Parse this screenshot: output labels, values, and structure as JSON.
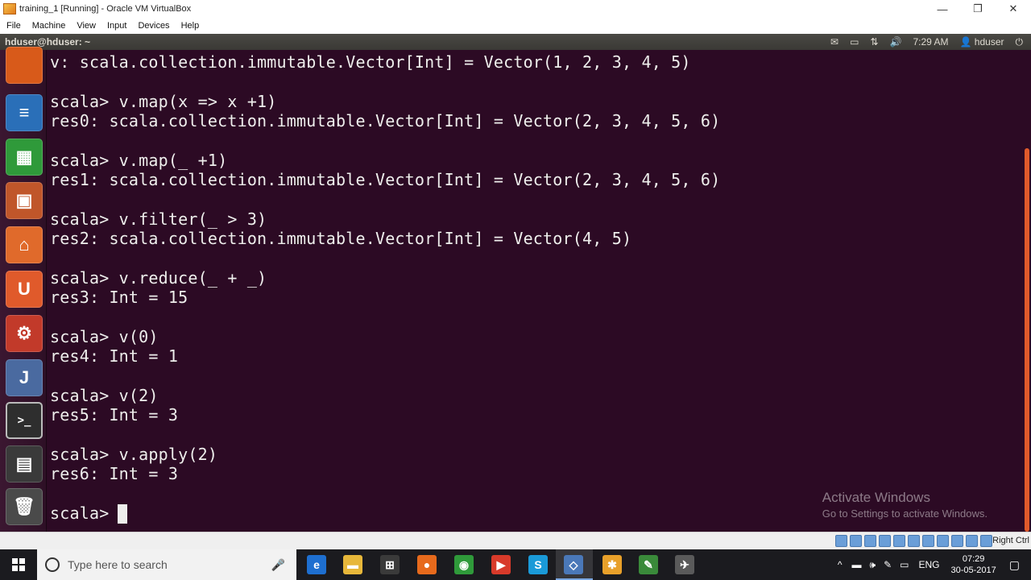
{
  "window": {
    "title": "training_1 [Running] - Oracle VM VirtualBox",
    "minimize_glyph": "—",
    "restore_glyph": "❐",
    "close_glyph": "✕"
  },
  "menubar": {
    "items": [
      "File",
      "Machine",
      "View",
      "Input",
      "Devices",
      "Help"
    ]
  },
  "panel": {
    "title": "hduser@hduser: ~",
    "time": "7:29 AM",
    "user": "hduser",
    "mail_glyph": "✉",
    "battery_glyph": "▭",
    "network_glyph": "⇅",
    "volume_glyph": "🔊",
    "user_glyph": "👤",
    "power_glyph": "⏻"
  },
  "launcher": {
    "icons": [
      {
        "name": "firefox-icon",
        "glyph": "",
        "color": "#d85a1a"
      },
      {
        "name": "writer-icon",
        "glyph": "≡",
        "color": "#2a6fb8"
      },
      {
        "name": "calc-icon",
        "glyph": "▦",
        "color": "#2f9a3a"
      },
      {
        "name": "impress-icon",
        "glyph": "▣",
        "color": "#c0562a"
      },
      {
        "name": "software-center-icon",
        "glyph": "⌂",
        "color": "#e06a2b"
      },
      {
        "name": "ubuntu-one-icon",
        "glyph": "U",
        "color": "#e05a2b"
      },
      {
        "name": "system-settings-icon",
        "glyph": "⚙",
        "color": "#c23a2a"
      },
      {
        "name": "intellij-icon",
        "glyph": "J",
        "color": "#4a6aa0"
      },
      {
        "name": "terminal-icon",
        "glyph": ">_",
        "color": "#2e2e2e"
      },
      {
        "name": "workspace-switcher-icon",
        "glyph": "▤",
        "color": "#3a3a3a"
      },
      {
        "name": "trash-icon",
        "glyph": "🗑",
        "color": "#4a4a4a"
      }
    ]
  },
  "terminal": {
    "lines": [
      "v: scala.collection.immutable.Vector[Int] = Vector(1, 2, 3, 4, 5)",
      "",
      "scala> v.map(x => x +1)",
      "res0: scala.collection.immutable.Vector[Int] = Vector(2, 3, 4, 5, 6)",
      "",
      "scala> v.map(_ +1)",
      "res1: scala.collection.immutable.Vector[Int] = Vector(2, 3, 4, 5, 6)",
      "",
      "scala> v.filter(_ > 3)",
      "res2: scala.collection.immutable.Vector[Int] = Vector(4, 5)",
      "",
      "scala> v.reduce(_ + _)",
      "res3: Int = 15",
      "",
      "scala> v(0)",
      "res4: Int = 1",
      "",
      "scala> v(2)",
      "res5: Int = 3",
      "",
      "scala> v.apply(2)",
      "res6: Int = 3",
      "",
      "scala> "
    ]
  },
  "watermark": {
    "line1": "Activate Windows",
    "line2": "Go to Settings to activate Windows."
  },
  "statusbar": {
    "host_key": "Right Ctrl"
  },
  "taskbar": {
    "search_placeholder": "Type here to search",
    "mic_glyph": "🎤",
    "apps": [
      {
        "name": "edge-icon",
        "glyph": "e",
        "color": "#1e6fd0"
      },
      {
        "name": "file-explorer-icon",
        "glyph": "▬",
        "color": "#e7b73a"
      },
      {
        "name": "store-icon",
        "glyph": "⊞",
        "color": "#3a3a3a"
      },
      {
        "name": "firefox-icon",
        "glyph": "●",
        "color": "#e76a1c"
      },
      {
        "name": "chrome-icon",
        "glyph": "◉",
        "color": "#2f9a3a"
      },
      {
        "name": "app-red-icon",
        "glyph": "▶",
        "color": "#d83a2a"
      },
      {
        "name": "skype-icon",
        "glyph": "S",
        "color": "#1a9ad8"
      },
      {
        "name": "virtualbox-icon",
        "glyph": "◇",
        "color": "#4a78b8"
      },
      {
        "name": "flower-app-icon",
        "glyph": "✱",
        "color": "#e8a02a"
      },
      {
        "name": "notepad-icon",
        "glyph": "✎",
        "color": "#3a8a3a"
      },
      {
        "name": "tool-icon",
        "glyph": "✈",
        "color": "#5a5a5a"
      }
    ],
    "tray": {
      "chevron": "^",
      "icons": [
        "▬",
        "🕪",
        "✎",
        "▭"
      ],
      "language": "ENG",
      "time": "07:29",
      "date": "30-05-2017",
      "notification_glyph": "▢"
    }
  }
}
